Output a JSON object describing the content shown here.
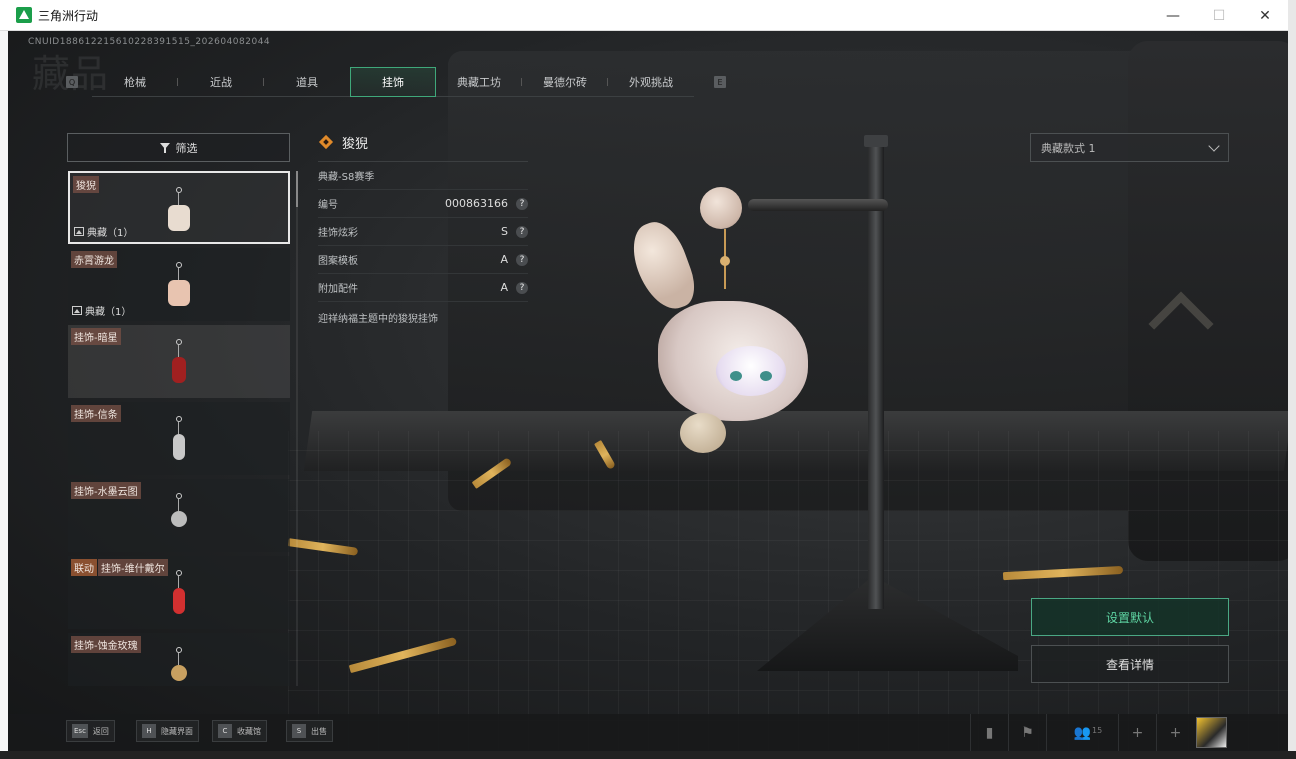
{
  "window": {
    "title": "三角洲行动",
    "min": "—",
    "max": "☐",
    "close": "✕"
  },
  "header": {
    "uid": "CNUID1886122156102283915​15_202604082044",
    "bg_title": "藏品"
  },
  "tabs": [
    {
      "label": "枪械",
      "active": false
    },
    {
      "label": "近战",
      "active": false
    },
    {
      "label": "道具",
      "active": false
    },
    {
      "label": "挂饰",
      "active": true
    },
    {
      "label": "典藏工坊",
      "active": false
    },
    {
      "label": "曼德尔砖",
      "active": false
    },
    {
      "label": "外观挑战",
      "active": false
    }
  ],
  "tab_keys": {
    "left": "Q",
    "right": "E"
  },
  "filter": {
    "label": "筛选"
  },
  "items": [
    {
      "name": "狻猊",
      "badge": "典藏（1）",
      "color": "#e8dcd0"
    },
    {
      "name": "赤霄游龙",
      "badge": "典藏（1）",
      "color": "#e8c4b0"
    },
    {
      "name": "挂饰-暗星",
      "badge": "",
      "color": "#a02020"
    },
    {
      "name": "挂饰-信条",
      "badge": "",
      "color": "#c8c8c8"
    },
    {
      "name": "挂饰-水墨云图",
      "badge": "",
      "color": "#bcbcbc"
    },
    {
      "name": "挂饰-维什戴尔",
      "prefix": "联动",
      "badge": "",
      "color": "#d23030"
    },
    {
      "name": "挂饰-蚀金玫瑰",
      "badge": "",
      "color": "#c8a060"
    }
  ],
  "detail": {
    "name": "狻猊",
    "season": "典藏-S8赛季",
    "rows": [
      {
        "label": "编号",
        "value": "000863166"
      },
      {
        "label": "挂饰炫彩",
        "value": "S"
      },
      {
        "label": "图案模板",
        "value": "A"
      },
      {
        "label": "附加配件",
        "value": "A"
      }
    ],
    "help": "?",
    "description": "迎祥纳福主题中的狻猊挂饰"
  },
  "style_select": {
    "value": "典藏款式 1"
  },
  "actions": {
    "set_default": "设置默认",
    "view_details": "查看详情"
  },
  "bottom_hints": [
    {
      "key": "Esc",
      "label": "返回"
    },
    {
      "key": "H",
      "label": "隐藏界面"
    },
    {
      "key": "C",
      "label": "收藏馆"
    },
    {
      "key": "S",
      "label": "出售"
    }
  ],
  "status": {
    "friends_count": "15"
  },
  "colors": {
    "accent": "#4aa884",
    "accent_text": "#5fd6a4",
    "tag_bg": "#78504a"
  }
}
